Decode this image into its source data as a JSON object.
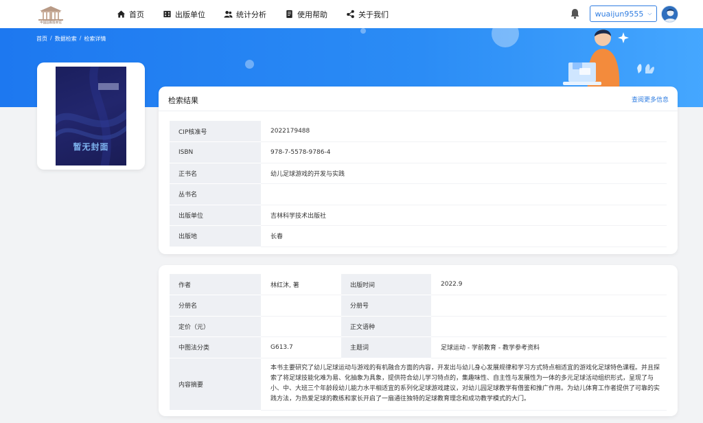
{
  "header": {
    "logo_text": "中国国家版本馆",
    "nav": [
      {
        "label": "首页",
        "icon": "home-icon"
      },
      {
        "label": "出版单位",
        "icon": "building-icon"
      },
      {
        "label": "统计分析",
        "icon": "users-icon"
      },
      {
        "label": "使用帮助",
        "icon": "document-icon"
      },
      {
        "label": "关于我们",
        "icon": "share-icon"
      }
    ],
    "username": "wuaijun9555"
  },
  "breadcrumb": [
    "首页",
    "数据检索",
    "检索详情"
  ],
  "cover": {
    "placeholder_text": "暂无封面"
  },
  "result": {
    "title": "检索结果",
    "more_link": "查阅更多信息",
    "rows": [
      {
        "label": "CIP核准号",
        "value": "2022179488"
      },
      {
        "label": "ISBN",
        "value": "978-7-5578-9786-4"
      },
      {
        "label": "正书名",
        "value": "幼儿足球游戏的开发与实践"
      },
      {
        "label": "丛书名",
        "value": ""
      },
      {
        "label": "出版单位",
        "value": "吉林科学技术出版社"
      },
      {
        "label": "出版地",
        "value": "长春"
      }
    ]
  },
  "detail": {
    "rows": [
      {
        "l1": "作者",
        "v1": "林红沐, 著",
        "l2": "出版时间",
        "v2": "2022.9"
      },
      {
        "l1": "分册名",
        "v1": "",
        "l2": "分册号",
        "v2": ""
      },
      {
        "l1": "定价（元）",
        "v1": "",
        "l2": "正文语种",
        "v2": ""
      },
      {
        "l1": "中图法分类",
        "v1": "G613.7",
        "l2": "主题词",
        "v2": "足球运动 - 学前教育 - 教学参考资料"
      }
    ],
    "abstract_label": "内容摘要",
    "abstract": "本书主要研究了幼儿足球运动与游戏的有机融合方面的内容，开发出与幼儿身心发展规律和学习方式特点相适宜的游戏化足球特色课程。并且探索了将足球技能化难为易、化抽象为具象，提供符合幼儿学习特点的，集趣味性、自主性与发展性为一体的多元足球活动组织形式，呈现了与小、中、大班三个年龄段幼儿能力水平相适宜的系列化足球游戏建议，对幼儿园足球教学有借鉴和推广作用。为幼儿体育工作者提供了可靠的实践方法，为热爱足球的教练和家长开启了一扇通往独特的足球教育理念和成功教学模式的大门。"
  }
}
